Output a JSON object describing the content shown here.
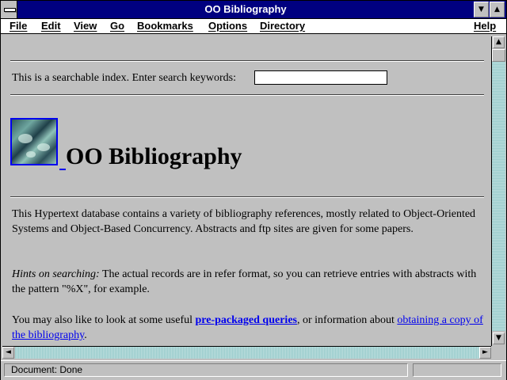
{
  "window": {
    "title": "OO Bibliography"
  },
  "menu": {
    "file": "File",
    "edit": "Edit",
    "view": "View",
    "go": "Go",
    "bookmarks": "Bookmarks",
    "options": "Options",
    "directory": "Directory",
    "help": "Help"
  },
  "content": {
    "search_label": "This is a searchable index. Enter search keywords:",
    "search_value": "",
    "heading": "OO Bibliography",
    "intro": "This Hypertext database contains a variety of bibliography references, mostly related to Object-Oriented Systems and Object-Based Concurrency. Abstracts and ftp sites are given for some papers.",
    "hints_label": "Hints on searching:",
    "hints_text": " The actual records are in refer format, so you can retrieve entries with abstracts with the pattern \"%X\", for example.",
    "also_prefix": "You may also like to look at some useful ",
    "prepackaged_link": "pre-packaged queries",
    "also_middle": ", or information about ",
    "obtaining_link": "obtaining a copy of the bibliography",
    "also_suffix": "."
  },
  "status": {
    "text": "Document: Done"
  },
  "colors": {
    "titlebar": "#000080",
    "link": "#0000ee",
    "background": "#c0c0c0"
  }
}
